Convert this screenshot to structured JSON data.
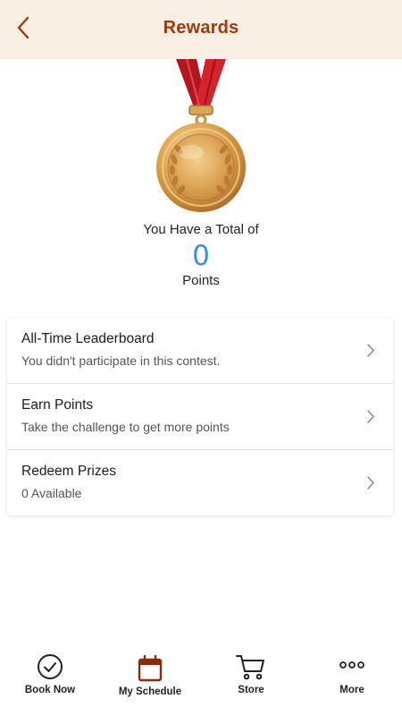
{
  "header": {
    "title": "Rewards"
  },
  "summary": {
    "total_label": "You Have a Total of",
    "points": "0",
    "points_label": "Points"
  },
  "menu": [
    {
      "title": "All-Time Leaderboard",
      "subtitle": "You didn't participate in this contest."
    },
    {
      "title": "Earn Points",
      "subtitle": "Take the challenge to get more points"
    },
    {
      "title": "Redeem Prizes",
      "subtitle": "0 Available"
    }
  ],
  "tabs": [
    {
      "label": "Book Now",
      "icon": "check-circle-icon"
    },
    {
      "label": "My Schedule",
      "icon": "calendar-icon"
    },
    {
      "label": "Store",
      "icon": "cart-icon"
    },
    {
      "label": "More",
      "icon": "more-dots-icon"
    }
  ],
  "colors": {
    "header_bg": "#f8efe2",
    "title": "#a3380d",
    "points": "#3c8ee0",
    "ribbon": "#c8202a",
    "medal_gold": "#d9a04a"
  }
}
